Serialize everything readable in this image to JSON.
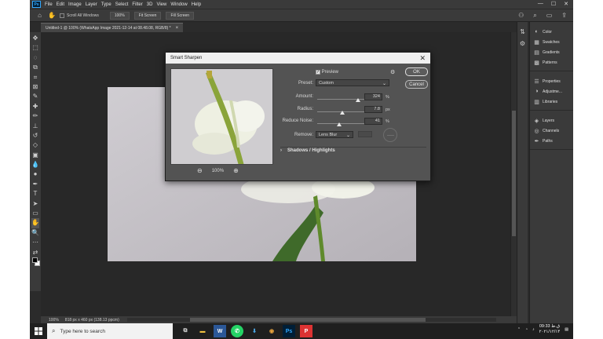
{
  "menubar": {
    "logo": "Ps",
    "items": [
      "File",
      "Edit",
      "Image",
      "Layer",
      "Type",
      "Select",
      "Filter",
      "3D",
      "View",
      "Window",
      "Help"
    ]
  },
  "options_bar": {
    "scroll_all_windows": "Scroll All Windows",
    "zoom_100": "100%",
    "fit_screen": "Fit Screen",
    "fill_screen": "Fill Screen"
  },
  "document_tab": {
    "title": "Untitled-1 @ 100% (WhatsApp Image 2021-12-14 at 08.48.08, RGB/8) *"
  },
  "panels": {
    "group1": [
      "Color",
      "Swatches",
      "Gradients",
      "Patterns"
    ],
    "group2": [
      "Properties",
      "Adjustme...",
      "Libraries"
    ],
    "group3": [
      "Layers",
      "Channels",
      "Paths"
    ]
  },
  "statusbar": {
    "zoom": "100%",
    "info": "818 px x 460 px (138.13 ppcm)"
  },
  "dialog": {
    "title": "Smart Sharpen",
    "preview_label": "Preview",
    "preview_checked": true,
    "preset_label": "Preset:",
    "preset_value": "Custom",
    "amount_label": "Amount:",
    "amount_value": "324",
    "amount_unit": "%",
    "amount_fraction": 0.65,
    "radius_label": "Radius:",
    "radius_value": "7.8",
    "radius_unit": "px",
    "radius_fraction": 0.4,
    "noise_label": "Reduce Noise:",
    "noise_value": "41",
    "noise_unit": "%",
    "noise_fraction": 0.35,
    "remove_label": "Remove:",
    "remove_value": "Lens Blur",
    "ok_label": "OK",
    "cancel_label": "Cancel",
    "shadows_label": "Shadows / Highlights",
    "zoom_value": "100%"
  },
  "taskbar": {
    "search_placeholder": "Type here to search",
    "time": "09:33 ق.ظ",
    "date": "۲۰۲۱/۱۲/۱۴"
  },
  "colors": {
    "ps_blue": "#31a8ff",
    "photo_bg": "#c8c5ca",
    "leaf_green": "#3f6a2a",
    "stem_green": "#5f8a2c",
    "flower_white": "#f2f3ea"
  }
}
